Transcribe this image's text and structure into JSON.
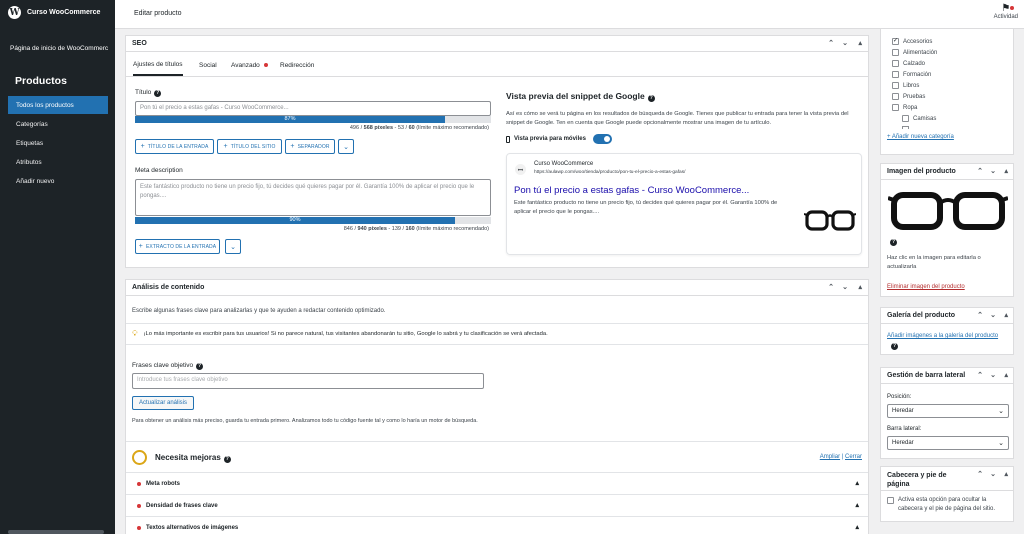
{
  "admin_bar": {
    "site_name": "Curso WooCommerce"
  },
  "sidebar": {
    "home_link": "Página de inicio de WooCommerc",
    "menu_head": "Productos",
    "items": [
      {
        "label": "Todos los productos",
        "active": true
      },
      {
        "label": "Categorías"
      },
      {
        "label": "Etiquetas"
      },
      {
        "label": "Atributos"
      },
      {
        "label": "Añadir nuevo"
      }
    ]
  },
  "header": {
    "title": "Editar producto",
    "activity_label": "Actividad"
  },
  "seo": {
    "title": "SEO",
    "tabs": [
      "Ajustes de títulos",
      "Social",
      "Avanzado",
      "Redirección"
    ],
    "title_field": {
      "label": "Título",
      "placeholder": "Pon tú el precio a estas gafas - Curso WooCommerce...",
      "progress_pct": 87,
      "progress_label": "87%",
      "count_pre": "496 / ",
      "count_bold1": "568 píxeles",
      "count_mid": " - 53 / ",
      "count_bold2": "60",
      "count_post": " (límite máximo recomendado)",
      "buttons": [
        "TÍTULO DE LA ENTRADA",
        "TÍTULO DEL SITIO",
        "SEPARADOR"
      ]
    },
    "meta_field": {
      "label": "Meta description",
      "placeholder": "Este fantástico producto no tiene un precio fijo, tú decides qué quieres pagar por él. Garantía 100% de aplicar el precio que le pongas....",
      "progress_pct": 90,
      "progress_label": "90%",
      "count_pre": "846 / ",
      "count_bold1": "940 píxeles",
      "count_mid": " - 139 / ",
      "count_bold2": "160",
      "count_post": " (límite máximo recomendado)",
      "buttons": [
        "EXTRACTO DE LA ENTRADA"
      ]
    },
    "preview": {
      "title": "Vista previa del snippet de Google",
      "description": "Así es cómo se verá tu página en los resultados de búsqueda de Google. Tienes que publicar tu entrada para tener la vista previa del snippet de Google. Ten en cuenta que Google puede opcionalmente mostrar una imagen de tu artículo.",
      "mobile_label": "Vista previa para móviles",
      "mobile_on": true,
      "site_name": "Curso WooCommerce",
      "url": "https://aulawp.com/woo/tienda/producto/pon-tu-el-precio-a-estas-gafas/",
      "result_title": "Pon tú el precio a estas gafas - Curso WooCommerce...",
      "result_desc": "Este fantástico producto no tiene un precio fijo, tú decides qué quieres pagar por él. Garantía 100% de aplicar el precio que le pongas...."
    }
  },
  "analysis": {
    "title": "Análisis de contenido",
    "intro": "Escribe algunas frases clave para analizarlas y que te ayuden a redactar contenido optimizado.",
    "tip": "¡Lo más importante es escribir para tus usuarios! Si no parece natural, tus visitantes abandonarán tu sitio, Google lo sabrá y tu clasificación se verá afectada.",
    "keyphrase_label": "Frases clave objetivo",
    "keyphrase_placeholder": "Introduce tus frases clave objetivo",
    "update_button": "Actualizar análisis",
    "note": "Para obtener un análisis más preciso, guarda tu entrada primero. Analizamos todo tu código fuente tal y como lo haría un motor de búsqueda.",
    "needs_title": "Necesita mejoras",
    "expand": "Ampliar",
    "separator": " | ",
    "close": "Cerrar",
    "issues": [
      "Meta robots",
      "Densidad de frases clave",
      "Textos alternativos de imágenes"
    ]
  },
  "categories": {
    "items": [
      {
        "label": "Accesorios",
        "checked": true,
        "indent": false
      },
      {
        "label": "Alimentación",
        "indent": false
      },
      {
        "label": "Calzado",
        "indent": false
      },
      {
        "label": "Formación",
        "indent": false
      },
      {
        "label": "Libros",
        "indent": false
      },
      {
        "label": "Pruebas",
        "indent": false
      },
      {
        "label": "Ropa",
        "indent": false
      },
      {
        "label": "Camisas",
        "indent": true
      }
    ],
    "add_link": "+ Añadir nueva categoría"
  },
  "product_image": {
    "title": "Imagen del producto",
    "help": "Haz clic en la imagen para editarla o actualizarla",
    "remove": "Eliminar imagen del producto"
  },
  "gallery": {
    "title": "Galería del producto",
    "link": "Añadir imágenes a la galería del producto"
  },
  "sidebar_mgmt": {
    "title": "Gestión de barra lateral",
    "position_label": "Posición:",
    "position_value": "Heredar",
    "bar_label": "Barra lateral:",
    "bar_value": "Heredar"
  },
  "header_footer": {
    "title": "Cabecera y pie de página",
    "option": "Activa esta opción para ocultar la cabecera y el pie de página del sitio."
  },
  "colors": {
    "accent": "#2271b1",
    "admin_dark": "#1d2327",
    "error": "#d63638",
    "warning": "#dba617",
    "link_google": "#1a0dab"
  }
}
